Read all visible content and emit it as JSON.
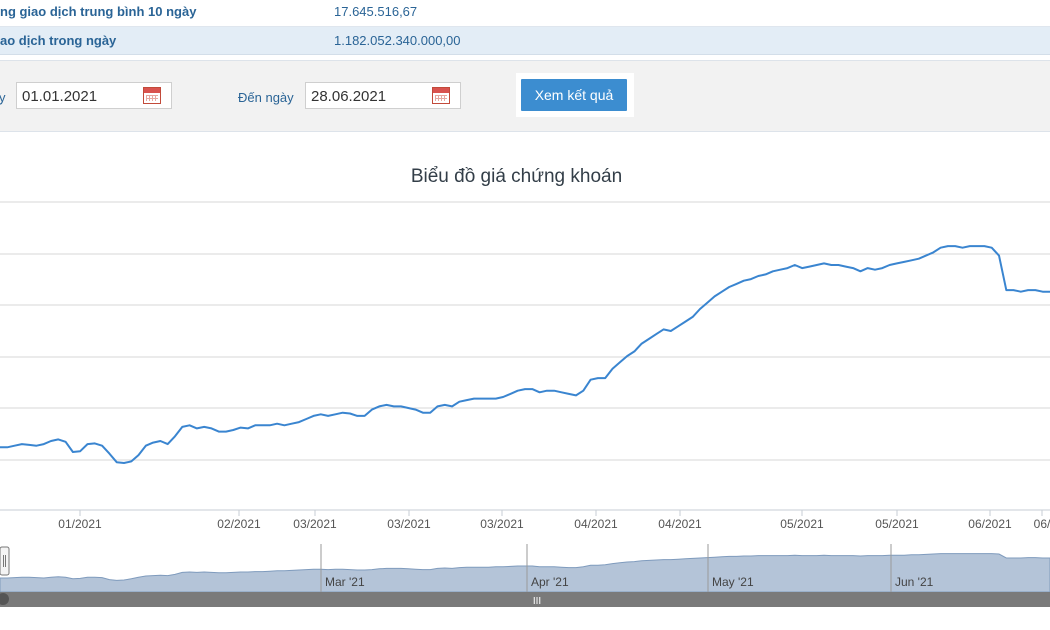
{
  "stats": {
    "avg_label": "ng giao dịch trung bình 10 ngày",
    "avg_value": "17.645.516,67",
    "day_label": "ao dịch trong ngày",
    "day_value": "1.182.052.340.000,00"
  },
  "filter": {
    "from_prefix": "y",
    "from_value": "01.01.2021",
    "to_label": "Đến ngày",
    "to_value": "28.06.2021",
    "submit_label": "Xem kết quả"
  },
  "icons": {
    "calendar": "calendar-icon",
    "navigator_handle": "grip-handle-icon",
    "scrollbar_grip": "grip-icon"
  },
  "colors": {
    "line": "#3a85d0",
    "button": "#3c8dd0",
    "navigator_fill": "#b4c4d8",
    "label": "#2a6496"
  },
  "chart_data": {
    "type": "line",
    "title": "Biểu đồ giá chứng khoán",
    "x_tick_labels": [
      "01/2021",
      "02/2021",
      "03/2021",
      "03/2021",
      "03/2021",
      "04/2021",
      "04/2021",
      "05/2021",
      "05/2021",
      "06/2021",
      "06/"
    ],
    "navigator_labels": [
      "Mar '21",
      "Apr '21",
      "May '21",
      "Jun '21"
    ],
    "navigator_grip": "III",
    "grid": true,
    "values": [
      1.0,
      1.0,
      1.1,
      1.2,
      1.15,
      1.1,
      1.2,
      1.4,
      1.5,
      1.35,
      0.7,
      0.75,
      1.2,
      1.25,
      1.1,
      0.6,
      0.05,
      0.0,
      0.1,
      0.5,
      1.1,
      1.3,
      1.4,
      1.2,
      1.7,
      2.3,
      2.4,
      2.2,
      2.3,
      2.2,
      2.0,
      2.0,
      2.1,
      2.25,
      2.2,
      2.4,
      2.4,
      2.4,
      2.5,
      2.4,
      2.5,
      2.6,
      2.8,
      3.0,
      3.1,
      3.0,
      3.1,
      3.2,
      3.15,
      3.0,
      3.0,
      3.4,
      3.6,
      3.7,
      3.6,
      3.6,
      3.5,
      3.4,
      3.2,
      3.2,
      3.6,
      3.7,
      3.6,
      3.9,
      4.0,
      4.1,
      4.1,
      4.1,
      4.1,
      4.2,
      4.4,
      4.6,
      4.7,
      4.7,
      4.5,
      4.6,
      4.6,
      4.5,
      4.4,
      4.3,
      4.6,
      5.3,
      5.4,
      5.4,
      6.0,
      6.4,
      6.8,
      7.1,
      7.6,
      7.9,
      8.2,
      8.5,
      8.4,
      8.7,
      9.0,
      9.3,
      9.8,
      10.2,
      10.6,
      10.9,
      11.2,
      11.4,
      11.6,
      11.7,
      11.9,
      12.0,
      12.2,
      12.3,
      12.4,
      12.6,
      12.4,
      12.5,
      12.6,
      12.7,
      12.6,
      12.6,
      12.5,
      12.4,
      12.2,
      12.4,
      12.3,
      12.4,
      12.6,
      12.7,
      12.8,
      12.9,
      13.0,
      13.2,
      13.4,
      13.7,
      13.8,
      13.8,
      13.7,
      13.8,
      13.8,
      13.8,
      13.7,
      13.2,
      11.0,
      11.0,
      10.9,
      11.0,
      11.0,
      10.9,
      10.9
    ],
    "navigator_values": [
      0.5,
      0.5,
      0.55,
      0.6,
      0.6,
      0.55,
      0.5,
      0.6,
      0.65,
      0.6,
      0.4,
      0.45,
      0.6,
      0.6,
      0.55,
      0.3,
      0.2,
      0.25,
      0.4,
      0.6,
      0.75,
      0.8,
      0.85,
      0.8,
      0.95,
      1.2,
      1.25,
      1.2,
      1.25,
      1.2,
      1.15,
      1.15,
      1.2,
      1.25,
      1.25,
      1.3,
      1.3,
      1.35,
      1.4,
      1.4,
      1.45,
      1.5,
      1.55,
      1.6,
      1.6,
      1.55,
      1.6,
      1.6,
      1.55,
      1.5,
      1.5,
      1.55,
      1.65,
      1.7,
      1.7,
      1.7,
      1.65,
      1.6,
      1.55,
      1.55,
      1.7,
      1.75,
      1.7,
      1.8,
      1.85,
      1.85,
      1.85,
      1.85,
      1.9,
      1.9,
      1.95,
      2.0,
      2.0,
      2.0,
      1.9,
      1.9,
      1.9,
      1.85,
      1.8,
      1.8,
      1.9,
      2.1,
      2.1,
      2.15,
      2.3,
      2.4,
      2.5,
      2.55,
      2.65,
      2.7,
      2.75,
      2.8,
      2.8,
      2.85,
      2.9,
      2.95,
      3.0,
      3.05,
      3.1,
      3.15,
      3.2,
      3.2,
      3.25,
      3.25,
      3.3,
      3.3,
      3.3,
      3.3,
      3.3,
      3.35,
      3.3,
      3.3,
      3.3,
      3.35,
      3.3,
      3.3,
      3.3,
      3.3,
      3.25,
      3.3,
      3.3,
      3.3,
      3.35,
      3.35,
      3.35,
      3.4,
      3.4,
      3.45,
      3.5,
      3.55,
      3.55,
      3.55,
      3.55,
      3.55,
      3.55,
      3.55,
      3.55,
      3.5,
      3.0,
      3.0,
      3.0,
      3.05,
      3.05,
      3.0,
      3.0
    ]
  }
}
